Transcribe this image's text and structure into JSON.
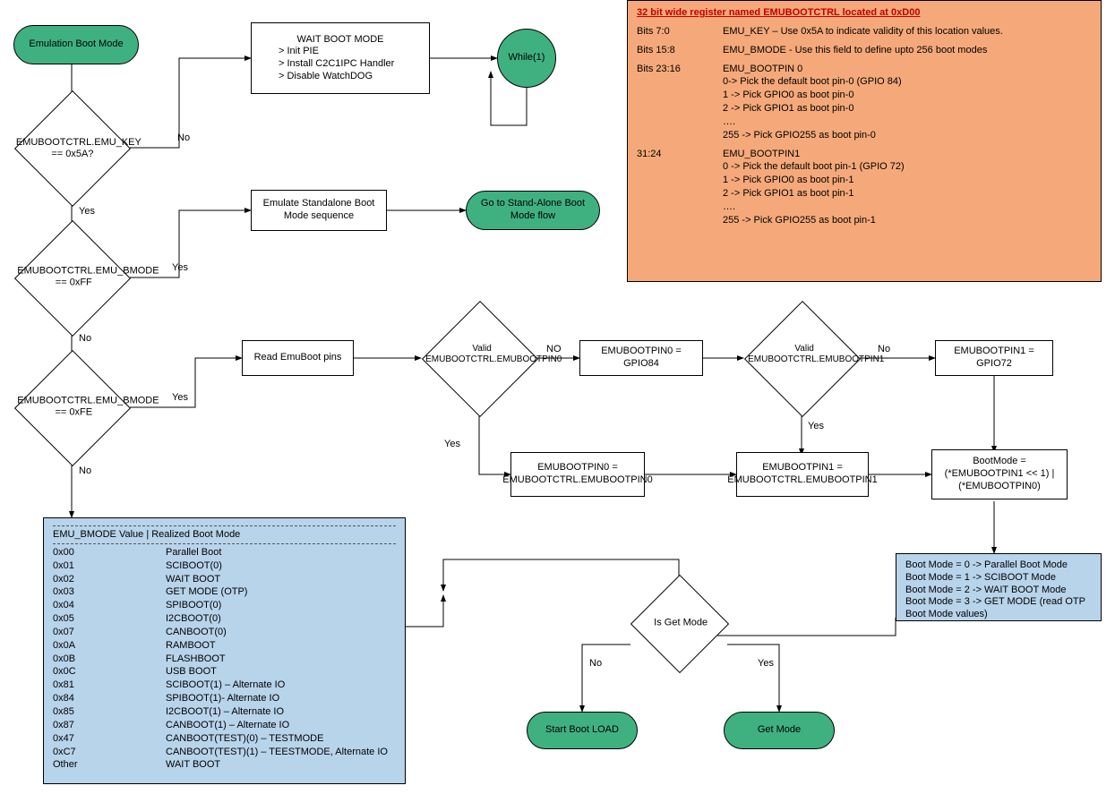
{
  "start": {
    "label": "Emulation Boot Mode"
  },
  "dec_key": {
    "label": "EMUBOOTCTRL.EMU_KEY == 0x5A?"
  },
  "dec_bmode_ff": {
    "label": "EMUBOOTCTRL.EMU_BMODE == 0xFF"
  },
  "dec_bmode_fe": {
    "label": "EMUBOOTCTRL.EMU_BMODE == 0xFE"
  },
  "wait_boot": {
    "title": "WAIT BOOT MODE",
    "l1": "> Init PIE",
    "l2": "> Install C2C1IPC Handler",
    "l3": "> Disable WatchDOG"
  },
  "while1": {
    "label": "While(1)"
  },
  "emu_standalone": {
    "label": "Emulate Standalone Boot Mode sequence"
  },
  "goto_standalone": {
    "label": "Go to Stand-Alone Boot Mode flow"
  },
  "read_pins": {
    "label": "Read EmuBoot pins"
  },
  "dec_valid_pin0": {
    "label": "Valid EMUBOOTCTRL.EMUBOOTPIN0"
  },
  "pin0_84": {
    "label": "EMUBOOTPIN0 = GPIO84"
  },
  "pin0_ctrl": {
    "label": "EMUBOOTPIN0 = EMUBOOTCTRL.EMUBOOTPIN0"
  },
  "dec_valid_pin1": {
    "label": "Valid EMUBOOTCTRL.EMUBOOTPIN1"
  },
  "pin1_72": {
    "label": "EMUBOOTPIN1 = GPIO72"
  },
  "pin1_ctrl": {
    "label": "EMUBOOTPIN1 = EMUBOOTCTRL.EMUBOOTPIN1"
  },
  "bootmode_calc": {
    "label": "BootMode = (*EMUBOOTPIN1 << 1) | (*EMUBOOTPIN0)"
  },
  "dec_is_get": {
    "label": "Is Get Mode"
  },
  "start_boot_load": {
    "label": "Start Boot LOAD"
  },
  "get_mode": {
    "label": "Get Mode"
  },
  "edge": {
    "no": "No",
    "yes": "Yes",
    "NO": "NO"
  },
  "reg_legend": {
    "title": "32 bit wide register named EMUBOOTCTRL located at 0xD00",
    "r1a": "Bits 7:0",
    "r1b": "EMU_KEY – Use 0x5A to indicate validity of this location values.",
    "r2a": "Bits 15:8",
    "r2b": "EMU_BMODE - Use this field to define upto 256 boot modes",
    "r3a": "Bits 23:16",
    "r3b": "EMU_BOOTPIN 0",
    "r3c": "0-> Pick the default boot pin-0 (GPIO 84)",
    "r3d": "1 -> Pick GPIO0 as boot pin-0",
    "r3e": "2 -> Pick GPIO1 as boot pin-0",
    "r3f": "….",
    "r3g": "255 -> Pick GPIO255 as boot pin-0",
    "r4a": "31:24",
    "r4b": "EMU_BOOTPIN1",
    "r4c": "0 -> Pick the default boot pin-1 (GPIO 72)",
    "r4d": "1 -> Pick GPIO0 as boot pin-1",
    "r4e": "2 -> Pick GPIO1 as boot pin-1",
    "r4f": "….",
    "r4g": "255 -> Pick GPIO255 as boot pin-1"
  },
  "bmode_legend": {
    "header": "EMU_BMODE Value  | Realized Boot Mode",
    "rows": [
      [
        "0x00",
        "Parallel Boot"
      ],
      [
        "0x01",
        "SCIBOOT(0)"
      ],
      [
        "0x02",
        "WAIT BOOT"
      ],
      [
        "0x03",
        "GET MODE (OTP)"
      ],
      [
        "0x04",
        "SPIBOOT(0)"
      ],
      [
        "0x05",
        "I2CBOOT(0)"
      ],
      [
        "0x07",
        "CANBOOT(0)"
      ],
      [
        "0x0A",
        "RAMBOOT"
      ],
      [
        "0x0B",
        "FLASHBOOT"
      ],
      [
        "0x0C",
        "USB BOOT"
      ],
      [
        "0x81",
        "SCIBOOT(1) – Alternate IO"
      ],
      [
        "0x84",
        "SPIBOOT(1)- Alternate IO"
      ],
      [
        "0x85",
        "I2CBOOT(1) – Alternate IO"
      ],
      [
        "0x87",
        "CANBOOT(1) – Alternate IO"
      ],
      [
        "0x47",
        "CANBOOT(TEST)(0) – TESTMODE"
      ],
      [
        "0xC7",
        "CANBOOT(TEST)(1) – TEESTMODE, Alternate IO"
      ],
      [
        "Other",
        "WAIT BOOT"
      ]
    ]
  },
  "bootmode_legend": {
    "l1": "Boot Mode = 0   -> Parallel Boot Mode",
    "l2": "Boot Mode = 1   -> SCIBOOT Mode",
    "l3": "Boot Mode = 2 -> WAIT BOOT Mode",
    "l4": "Boot Mode = 3 -> GET MODE (read OTP Boot Mode values)"
  }
}
